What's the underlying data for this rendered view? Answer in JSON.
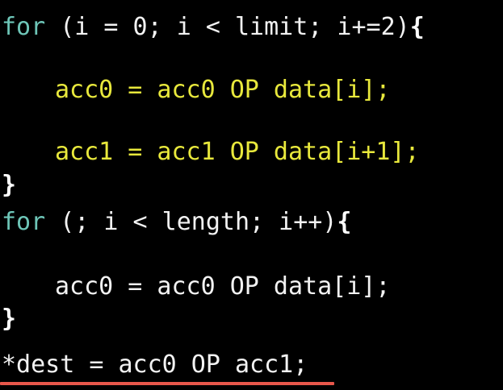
{
  "colors": {
    "background": "#000000",
    "keyword": "#6ec6b8",
    "default_text": "#f2f2f2",
    "highlight_text": "#e8e83c",
    "underline": "#e8574b"
  },
  "code": {
    "line1": {
      "keyword": "for",
      "rest": " (i = 0; i < limit; i+=2)",
      "brace": "{"
    },
    "line2": {
      "text": "acc0 = acc0 OP data[i];"
    },
    "line3": {
      "text": "acc1 = acc1 OP data[i+1];"
    },
    "line4": {
      "brace": "}"
    },
    "line5": {
      "keyword": "for",
      "rest": " (; i < length; i++)",
      "brace": "{"
    },
    "line6": {
      "text": "acc0 = acc0 OP data[i];"
    },
    "line7": {
      "brace": "}"
    },
    "line8": {
      "text": "*dest = acc0 OP acc1;"
    }
  }
}
